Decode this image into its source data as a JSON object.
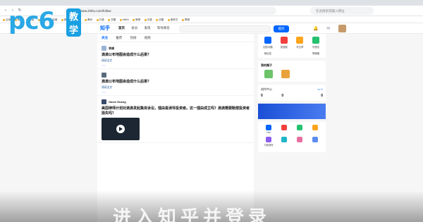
{
  "browser": {
    "url": "https://www.zhihu.com/follow",
    "search_placeholder": "在此搜索或输入网址",
    "bookmarks": [
      "应用",
      "知乎",
      "淘宝",
      "京东",
      "百度",
      "新浪",
      "网易",
      "腾讯",
      "抖音",
      "豆瓣",
      "bilibili",
      "微博",
      "天猫",
      "优酷",
      "爱奇艺",
      "携程"
    ]
  },
  "watermark": {
    "brand": "pc6",
    "badge": "教学",
    "subtitle": "进入知乎并登录"
  },
  "header": {
    "logo": "知乎",
    "nav": [
      "首页",
      "会员",
      "发现",
      "等你来答"
    ],
    "search_placeholder": "",
    "ask_button": "提问"
  },
  "feed": {
    "tabs": [
      "关注",
      "推荐",
      "热榜",
      "视频"
    ],
    "cards": [
      {
        "meta": "",
        "author": "李楠",
        "bio": "",
        "question": "滴滴公布地图会造成什么后果？",
        "excerpt": "",
        "read_more": "阅读全文",
        "votes": "",
        "actions": [
          "",
          "",
          "",
          "",
          ""
        ]
      },
      {
        "meta": "",
        "author": "",
        "bio": "",
        "question": "滴滴公布地图会造成什么后果？",
        "excerpt": "",
        "read_more": "阅读全文",
        "votes": "",
        "actions": [
          "",
          "",
          "",
          "",
          ""
        ]
      },
      {
        "meta": "",
        "author": "Gavin Huang",
        "bio": "",
        "question": "美国律师计划对滴滴发起集体诉讼，理由是误导投资者。这一理由成立吗？滴滴需要赔偿投资者损失吗？",
        "excerpt": "",
        "read_more": ""
      }
    ]
  },
  "sidebar": {
    "create": [
      "回答问题",
      "发视频",
      "写文章",
      "写想法"
    ],
    "create_bottom": [
      "稍后答",
      "草稿箱"
    ],
    "circles_title": "我的圈子",
    "circles": [
      "",
      ""
    ],
    "center": {
      "title": "创作中心",
      "level": "Lv 1",
      "stats": [
        {
          "label": "",
          "value": "0"
        },
        {
          "label": "",
          "value": "0"
        },
        {
          "label": "",
          "value": ""
        },
        {
          "label": "",
          "value": "0"
        }
      ]
    },
    "promo": "",
    "tools": [
      "Live",
      "",
      "",
      "",
      "付费咨询",
      "",
      "",
      ""
    ]
  }
}
